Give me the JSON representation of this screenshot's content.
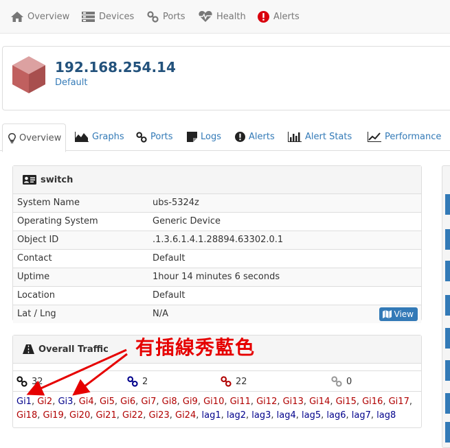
{
  "nav": {
    "overview": "Overview",
    "devices": "Devices",
    "ports": "Ports",
    "health": "Health",
    "alerts": "Alerts"
  },
  "device": {
    "ip": "192.168.254.14",
    "group": "Default"
  },
  "tabs": {
    "overview": "Overview",
    "graphs": "Graphs",
    "ports": "Ports",
    "logs": "Logs",
    "alerts": "Alerts",
    "alert_stats": "Alert Stats",
    "performance": "Performance"
  },
  "switch_panel": {
    "title": "switch",
    "rows": [
      {
        "label": "System Name",
        "value": "ubs-5324z"
      },
      {
        "label": "Operating System",
        "value": "Generic Device"
      },
      {
        "label": "Object ID",
        "value": ".1.3.6.1.4.1.28894.63302.0.1"
      },
      {
        "label": "Contact",
        "value": "Default"
      },
      {
        "label": "Uptime",
        "value": "1hour 14 minutes 6 seconds"
      },
      {
        "label": "Location",
        "value": "Default"
      },
      {
        "label": "Lat / Lng",
        "value": "N/A"
      }
    ],
    "view_button": "View"
  },
  "traffic_panel": {
    "title": "Overall Traffic",
    "stats": {
      "total": "32",
      "up": "2",
      "down": "22",
      "disabled": "0"
    },
    "ports_line1": [
      "Gi1",
      "Gi2",
      "Gi3",
      "Gi4",
      "Gi5",
      "Gi6",
      "Gi7",
      "Gi8",
      "Gi9",
      "Gi10",
      "Gi11",
      "Gi12",
      "Gi13",
      "Gi14",
      "Gi15",
      "Gi16",
      "Gi17"
    ],
    "ports_line1_status": [
      "up",
      "down",
      "up",
      "down",
      "down",
      "down",
      "down",
      "down",
      "down",
      "down",
      "down",
      "down",
      "down",
      "down",
      "down",
      "down",
      "down"
    ],
    "ports_line2": [
      "Gi18",
      "Gi19",
      "Gi20",
      "Gi21",
      "Gi22",
      "Gi23",
      "Gi24",
      "lag1",
      "lag2",
      "lag3",
      "lag4",
      "lag5",
      "lag6",
      "lag7",
      "lag8"
    ],
    "ports_line2_status": [
      "down",
      "down",
      "down",
      "down",
      "down",
      "down",
      "down",
      "up",
      "up",
      "up",
      "up",
      "up",
      "up",
      "up",
      "up"
    ]
  },
  "annotation": "有插線秀藍色",
  "colors": {
    "link_blue": "#337ab7",
    "port_up": "#00008b",
    "port_down": "#b00000",
    "annotation_red": "#e60000"
  }
}
